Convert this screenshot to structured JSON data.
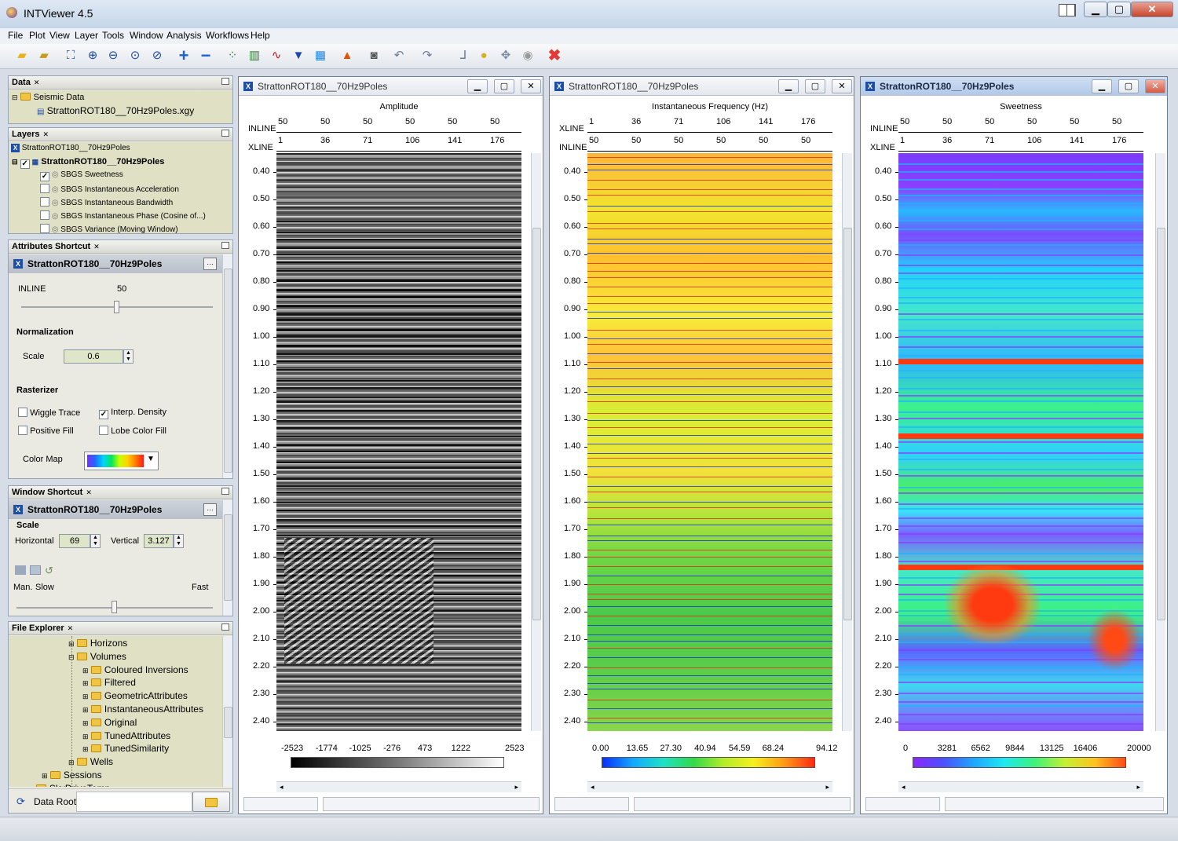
{
  "app": {
    "title": "INTViewer 4.5"
  },
  "menu": [
    "File",
    "Plot",
    "View",
    "Layer",
    "Tools",
    "Window",
    "Analysis",
    "Workflows",
    "Help"
  ],
  "toolbar_icons": [
    "open-folder-icon",
    "open-session-icon",
    "zoom-fit-icon",
    "zoom-in-icon",
    "zoom-out-icon",
    "zoom-rect-icon",
    "zoom-reset-icon",
    "add-layer-icon",
    "remove-layer-icon",
    "scatter-plot-icon",
    "histogram-icon",
    "xy-plot-icon",
    "crossplot-icon",
    "map-view-icon",
    "matlab-icon",
    "snapshot-icon",
    "undo-icon",
    "redo-icon",
    "measure-icon",
    "hint-icon",
    "tools-icon",
    "palette-icon",
    "delete-icon"
  ],
  "data_panel": {
    "title": "Data",
    "root": "Seismic Data",
    "file": "StrattonROT180__70Hz9Poles.xgy"
  },
  "layers_panel": {
    "title": "Layers",
    "root": "StrattonROT180__70Hz9Poles",
    "dataset": "StrattonROT180__70Hz9Poles",
    "items": [
      {
        "label": "SBGS Sweetness",
        "checked": true
      },
      {
        "label": "SBGS Instantaneous Acceleration",
        "checked": false
      },
      {
        "label": "SBGS Instantaneous Bandwidth",
        "checked": false
      },
      {
        "label": "SBGS Instantaneous Phase (Cosine of...)",
        "checked": false
      },
      {
        "label": "SBGS Variance (Moving Window)",
        "checked": false
      }
    ]
  },
  "attributes_panel": {
    "title": "Attributes Shortcut",
    "dataset": "StrattonROT180__70Hz9Poles",
    "inline_label": "INLINE",
    "inline_value": "50",
    "inline_fraction": 0.5,
    "normalization_label": "Normalization",
    "scale_label": "Scale",
    "scale_value": "0.6",
    "rasterizer_label": "Rasterizer",
    "wiggle": "Wiggle Trace",
    "interp": "Interp. Density",
    "positive": "Positive Fill",
    "lobe": "Lobe Color Fill",
    "color_map": "Color Map"
  },
  "window_panel": {
    "title": "Window Shortcut",
    "dataset": "StrattonROT180__70Hz9Poles",
    "scale_label": "Scale",
    "horizontal_label": "Horizontal",
    "horizontal_value": "69",
    "vertical_label": "Vertical",
    "vertical_value": "3.127",
    "man": "Man.",
    "slow": "Slow",
    "fast": "Fast",
    "speed_fraction": 0.5
  },
  "file_panel": {
    "title": "File Explorer",
    "items": [
      {
        "label": "Horizons",
        "level": 3
      },
      {
        "label": "Volumes",
        "level": 3
      },
      {
        "label": "Coloured Inversions",
        "level": 4
      },
      {
        "label": "Filtered",
        "level": 4
      },
      {
        "label": "GeometricAttributes",
        "level": 4
      },
      {
        "label": "InstantaneousAttributes",
        "level": 4
      },
      {
        "label": "Original",
        "level": 4
      },
      {
        "label": "TunedAttributes",
        "level": 4
      },
      {
        "label": "TunedSimilarity",
        "level": 4
      },
      {
        "label": "Wells",
        "level": 3
      },
      {
        "label": "Sessions",
        "level": 2
      },
      {
        "label": "SkyDriveTemp",
        "level": 1
      }
    ],
    "data_root": "Data Root:"
  },
  "views": [
    {
      "title": "StrattonROT180__70Hz9Poles",
      "plot_title": "Amplitude",
      "active": false,
      "row1_label": "INLINE",
      "row1": [
        "50",
        "50",
        "50",
        "50",
        "50",
        "50"
      ],
      "row2_label": "XLINE",
      "row2": [
        "1",
        "36",
        "71",
        "106",
        "141",
        "176"
      ],
      "cbar": [
        "-2523",
        "-1774",
        "-1025",
        "-276",
        "473",
        "1222",
        "2523"
      ],
      "palette": "gray"
    },
    {
      "title": "StrattonROT180__70Hz9Poles",
      "plot_title": "Instantaneous Frequency (Hz)",
      "active": false,
      "row1_label": "XLINE",
      "row1": [
        "1",
        "36",
        "71",
        "106",
        "141",
        "176"
      ],
      "row2_label": "INLINE",
      "row2": [
        "50",
        "50",
        "50",
        "50",
        "50",
        "50"
      ],
      "cbar": [
        "0.00",
        "13.65",
        "27.30",
        "40.94",
        "54.59",
        "68.24",
        "94.12"
      ],
      "palette": "freq"
    },
    {
      "title": "StrattonROT180__70Hz9Poles",
      "plot_title": "Sweetness",
      "active": true,
      "row1_label": "INLINE",
      "row1": [
        "50",
        "50",
        "50",
        "50",
        "50",
        "50"
      ],
      "row2_label": "XLINE",
      "row2": [
        "1",
        "36",
        "71",
        "106",
        "141",
        "176"
      ],
      "cbar": [
        "0",
        "3281",
        "6562",
        "9844",
        "13125",
        "16406",
        "20000"
      ],
      "palette": "sweet"
    }
  ],
  "time_ticks": [
    "0.40",
    "0.50",
    "0.60",
    "0.70",
    "0.80",
    "0.90",
    "1.00",
    "1.10",
    "1.20",
    "1.30",
    "1.40",
    "1.50",
    "1.60",
    "1.70",
    "1.80",
    "1.90",
    "2.00",
    "2.10",
    "2.20",
    "2.30",
    "2.40"
  ],
  "colors": {
    "accent": "#1e4fa8",
    "close": "#c8452d"
  }
}
